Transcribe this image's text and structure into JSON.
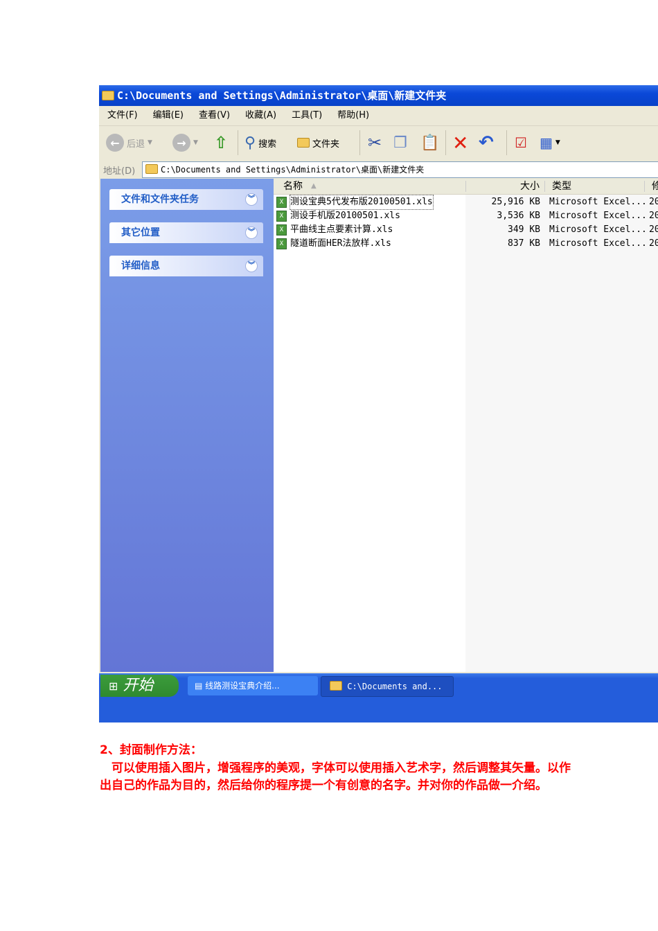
{
  "window": {
    "title": "C:\\Documents and Settings\\Administrator\\桌面\\新建文件夹",
    "menu": [
      "文件(F)",
      "编辑(E)",
      "查看(V)",
      "收藏(A)",
      "工具(T)",
      "帮助(H)"
    ],
    "toolbar": {
      "back": "后退",
      "search": "搜索",
      "folders": "文件夹"
    },
    "address_label": "地址(D)",
    "address": "C:\\Documents and Settings\\Administrator\\桌面\\新建文件夹",
    "tasks": [
      "文件和文件夹任务",
      "其它位置",
      "详细信息"
    ],
    "columns": {
      "name": "名称",
      "size": "大小",
      "type": "类型",
      "date": "修"
    },
    "files": [
      {
        "name": "测设宝典5代发布版20100501.xls",
        "size": "25,916 KB",
        "type": "Microsoft Excel...",
        "date": "20"
      },
      {
        "name": "测设手机版20100501.xls",
        "size": "3,536 KB",
        "type": "Microsoft Excel...",
        "date": "20"
      },
      {
        "name": "平曲线主点要素计算.xls",
        "size": "349 KB",
        "type": "Microsoft Excel...",
        "date": "20"
      },
      {
        "name": "隧道断面HER法放样.xls",
        "size": "837 KB",
        "type": "Microsoft Excel...",
        "date": "20"
      }
    ]
  },
  "taskbar": {
    "start": "开始",
    "items": [
      "线路测设宝典介绍...",
      "C:\\Documents and..."
    ]
  },
  "doc": {
    "heading": "2、封面制作方法：",
    "body": "　可以使用插入图片，增强程序的美观，字体可以使用插入艺术字，然后调整其矢量。以作出自己的作品为目的，然后给你的程序提一个有创意的名字。并对你的作品做一介绍。"
  }
}
